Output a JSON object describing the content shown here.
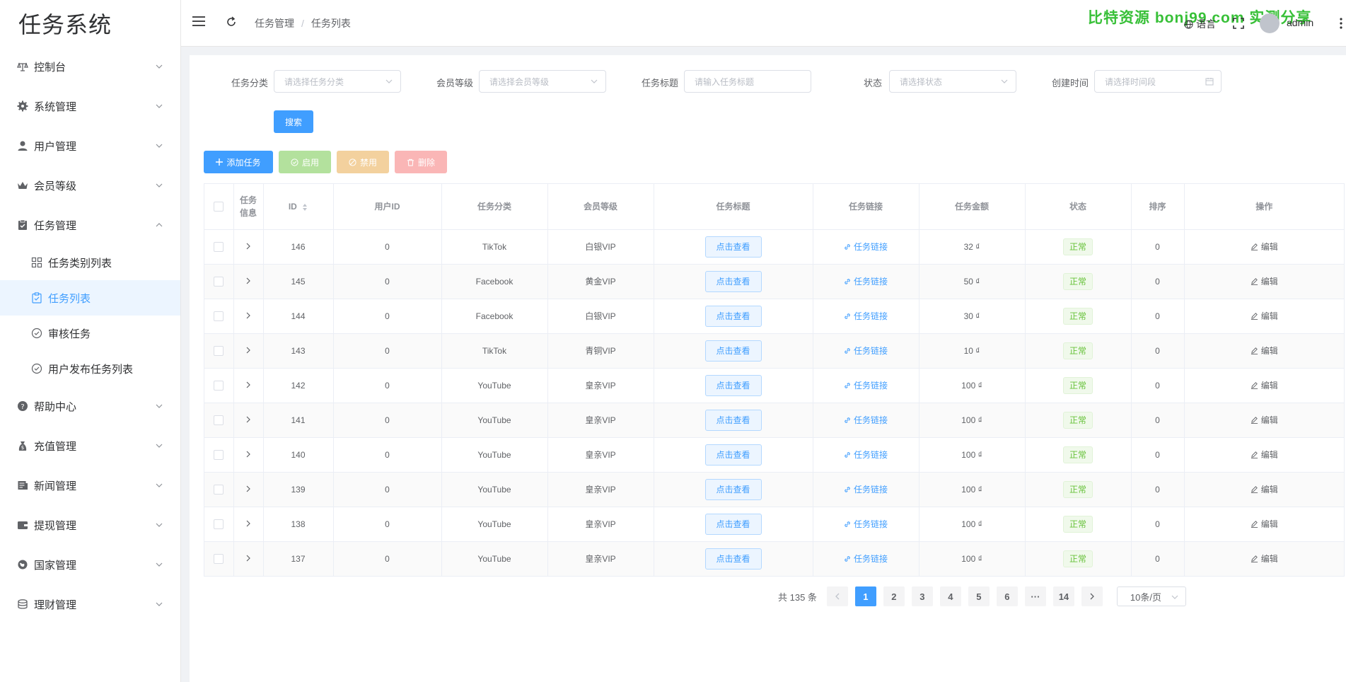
{
  "brand": "任务系统",
  "sidebar": {
    "items": [
      {
        "label": "控制台",
        "icon": "dashboard-icon"
      },
      {
        "label": "系统管理",
        "icon": "gear-icon"
      },
      {
        "label": "用户管理",
        "icon": "user-icon"
      },
      {
        "label": "会员等级",
        "icon": "crown-icon"
      },
      {
        "label": "任务管理",
        "icon": "task-icon",
        "expanded": true
      },
      {
        "label": "帮助中心",
        "icon": "help-icon"
      },
      {
        "label": "充值管理",
        "icon": "recharge-icon"
      },
      {
        "label": "新闻管理",
        "icon": "news-icon"
      },
      {
        "label": "提现管理",
        "icon": "wallet-icon"
      },
      {
        "label": "国家管理",
        "icon": "globe-icon"
      },
      {
        "label": "理财管理",
        "icon": "coins-icon"
      }
    ],
    "submenu": [
      {
        "label": "任务类别列表",
        "icon": "grid-icon"
      },
      {
        "label": "任务列表",
        "icon": "clipboard-icon",
        "active": true
      },
      {
        "label": "审核任务",
        "icon": "check-circle-icon"
      },
      {
        "label": "用户发布任务列表",
        "icon": "check-circle-icon"
      }
    ]
  },
  "header": {
    "breadcrumb": [
      "任务管理",
      "任务列表"
    ],
    "breadcrumb_sep": "/",
    "watermark": "比特资源 bonj99.com 实测分享",
    "language": "语言",
    "username": "admin"
  },
  "filters": {
    "category": {
      "label": "任务分类",
      "placeholder": "请选择任务分类"
    },
    "level": {
      "label": "会员等级",
      "placeholder": "请选择会员等级"
    },
    "title": {
      "label": "任务标题",
      "placeholder": "请输入任务标题"
    },
    "status": {
      "label": "状态",
      "placeholder": "请选择状态"
    },
    "created": {
      "label": "创建时间",
      "placeholder": "请选择时间段"
    },
    "search_label": "搜索"
  },
  "toolbar": {
    "add": "添加任务",
    "enable": "启用",
    "disable": "禁用",
    "delete": "删除"
  },
  "table": {
    "headers": {
      "info": "任务信息",
      "id": "ID",
      "user_id": "用户ID",
      "category": "任务分类",
      "level": "会员等级",
      "title": "任务标题",
      "link": "任务链接",
      "amount": "任务金额",
      "status": "状态",
      "sort": "排序",
      "actions": "操作"
    },
    "view_label": "点击查看",
    "link_label": "任务链接",
    "edit_label": "编辑",
    "rows": [
      {
        "id": "146",
        "user_id": "0",
        "category": "TikTok",
        "level": "白银VIP",
        "amount": "32 ₫",
        "status": "正常",
        "sort": "0"
      },
      {
        "id": "145",
        "user_id": "0",
        "category": "Facebook",
        "level": "黄金VIP",
        "amount": "50 ₫",
        "status": "正常",
        "sort": "0"
      },
      {
        "id": "144",
        "user_id": "0",
        "category": "Facebook",
        "level": "白银VIP",
        "amount": "30 ₫",
        "status": "正常",
        "sort": "0"
      },
      {
        "id": "143",
        "user_id": "0",
        "category": "TikTok",
        "level": "青铜VIP",
        "amount": "10 ₫",
        "status": "正常",
        "sort": "0"
      },
      {
        "id": "142",
        "user_id": "0",
        "category": "YouTube",
        "level": "皇亲VIP",
        "amount": "100 ₫",
        "status": "正常",
        "sort": "0"
      },
      {
        "id": "141",
        "user_id": "0",
        "category": "YouTube",
        "level": "皇亲VIP",
        "amount": "100 ₫",
        "status": "正常",
        "sort": "0"
      },
      {
        "id": "140",
        "user_id": "0",
        "category": "YouTube",
        "level": "皇亲VIP",
        "amount": "100 ₫",
        "status": "正常",
        "sort": "0"
      },
      {
        "id": "139",
        "user_id": "0",
        "category": "YouTube",
        "level": "皇亲VIP",
        "amount": "100 ₫",
        "status": "正常",
        "sort": "0"
      },
      {
        "id": "138",
        "user_id": "0",
        "category": "YouTube",
        "level": "皇亲VIP",
        "amount": "100 ₫",
        "status": "正常",
        "sort": "0"
      },
      {
        "id": "137",
        "user_id": "0",
        "category": "YouTube",
        "level": "皇亲VIP",
        "amount": "100 ₫",
        "status": "正常",
        "sort": "0"
      }
    ]
  },
  "pagination": {
    "total_text": "共 135 条",
    "pages": [
      "1",
      "2",
      "3",
      "4",
      "5",
      "6",
      "···",
      "14"
    ],
    "current": "1",
    "page_size": "10条/页"
  },
  "colors": {
    "primary": "#409eff",
    "success": "#67c23a",
    "watermark": "#38c038"
  }
}
